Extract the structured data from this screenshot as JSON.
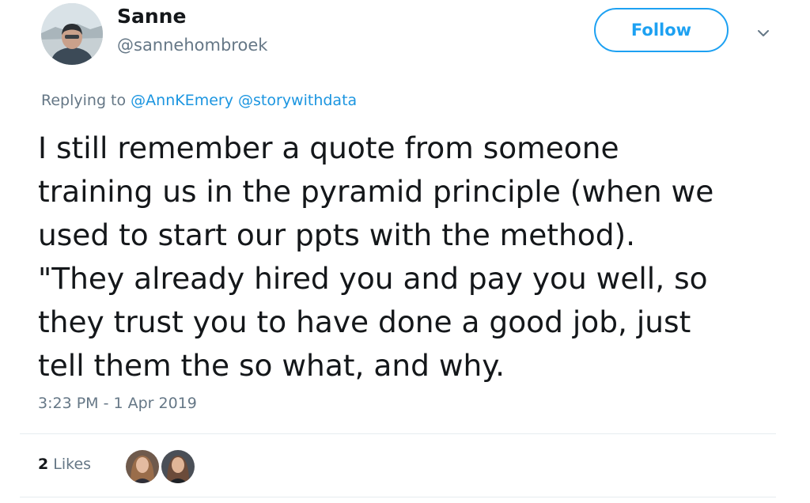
{
  "user": {
    "display_name": "Sanne",
    "handle": "@sannehombroek",
    "avatar_icon": "user-avatar"
  },
  "follow_button": {
    "label": "Follow",
    "color": "#1da1f2"
  },
  "menu_icon": "chevron-down-icon",
  "reply_context": {
    "prefix": "Replying to",
    "mentions": [
      "@AnnKEmery",
      "@storywithdata"
    ]
  },
  "tweet": {
    "lines": [
      "I still remember a quote from someone",
      "training us in the pyramid principle (when we",
      "used to start our ppts with the method).",
      "\"They already hired you and pay you well, so",
      "they trust you to have done a good job, just",
      "tell them the so what, and why."
    ],
    "timestamp": "3:23 PM - 1 Apr 2019"
  },
  "likes": {
    "count": "2",
    "label": "Likes",
    "avatars": [
      "liker-avatar-1",
      "liker-avatar-2"
    ]
  },
  "colors": {
    "text": "#14171a",
    "secondary_text": "#657786",
    "link": "#1b95e0",
    "divider": "#e6ecf0"
  }
}
